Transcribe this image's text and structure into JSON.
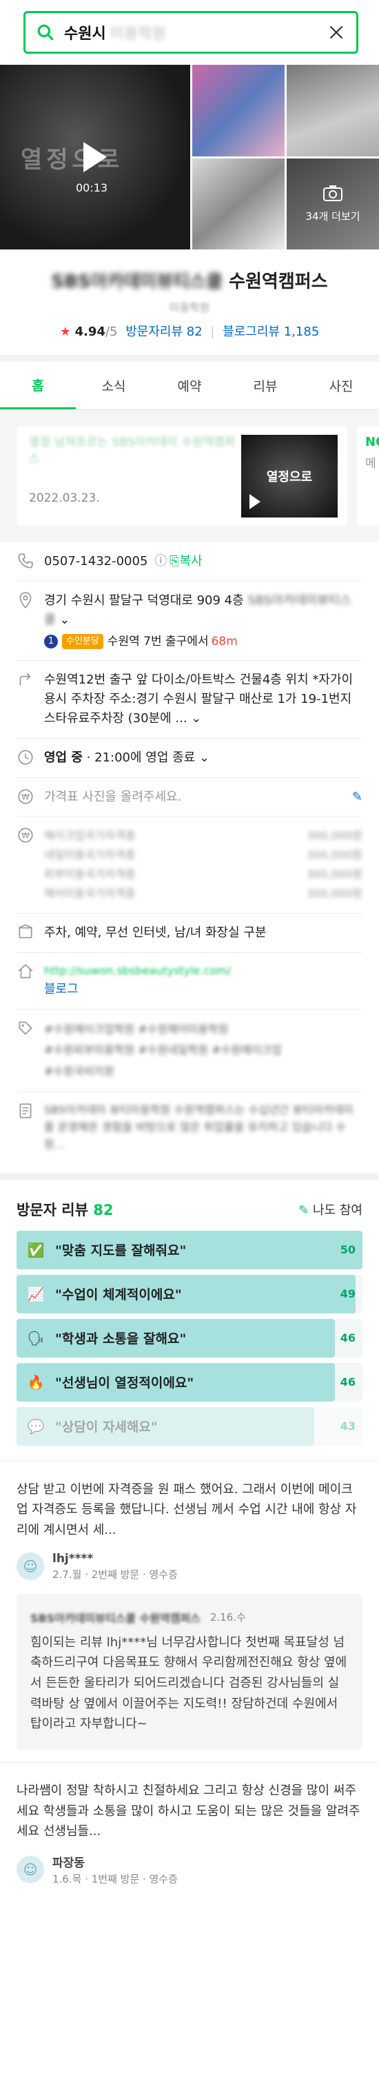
{
  "search": {
    "query": "수원시",
    "query_blurred": "미용학원"
  },
  "gallery": {
    "video_duration": "00:13",
    "video_caption": "열정으로",
    "more_label": "34개 더보기"
  },
  "place": {
    "name_blurred": "SBS아카데미뷰티스쿨",
    "name": "수원역캠퍼스",
    "category": "미용학원",
    "rating": "4.94",
    "rating_max": "/5",
    "visitor_reviews": "방문자리뷰 82",
    "blog_reviews": "블로그리뷰 1,185"
  },
  "tabs": [
    "홈",
    "소식",
    "예약",
    "리뷰",
    "사진"
  ],
  "news": {
    "title": "열정 넘쳐흐르는 SBS아카데미 수원역캠퍼스",
    "date": "2022.03.23.",
    "thumb_text": "열정으로",
    "peek_title": "NO",
    "peek_sub": "메"
  },
  "info": {
    "phone": "0507-1432-0005",
    "copy": "복사",
    "address": "경기 수원시 팔달구 덕영대로 909 4층",
    "address_blurred": "SBS아카데미뷰티스쿨",
    "subway_num": "1",
    "subway_line": "수인분당",
    "subway_text": "수원역 7번 출구에서",
    "subway_dist": "68m",
    "directions": "수원역12번 출구 앞 다이소/아트박스 건물4층 위치 *자가이용시 주차장 주소:경기 수원시 팔달구 매산로 1가 19-1번지 스타유료주차장 (30분에 ...",
    "hours_status": "영업 중",
    "hours_text": "21:00에 영업 종료",
    "price_note": "가격표 사진을 올려주세요.",
    "prices": [
      {
        "name": "메이크업국가자격증",
        "price": "300,000원"
      },
      {
        "name": "네일미용국가자격증",
        "price": "300,000원"
      },
      {
        "name": "피부미용국가자격증",
        "price": "300,000원"
      },
      {
        "name": "헤어미용국가자격증",
        "price": "300,000원"
      }
    ],
    "amenities": "주차, 예약, 무선 인터넷, 남/녀 화장실 구분",
    "url": "http://suwon.sbsbeautystyle.com/",
    "blog": "블로그",
    "tags_line1": "#수원메이크업학원  #수원헤어미용학원",
    "tags_line2": "#수원피부미용학원  #수원네일학원  #수원메이크업",
    "tags_line3": "#수원국비지원",
    "desc": "SBS아카데미 뷰티미용학원 수원역캠퍼스는 수십년간 뷰티아카데미를 운영해온 경험을 바탕으로 많은 취업률을 유지하고 있습니다 수원..."
  },
  "reviews_header": {
    "title": "방문자 리뷰",
    "count": "82",
    "join": "나도 참여"
  },
  "keywords": [
    {
      "emoji": "✅",
      "label": "\"맞춤 지도를 잘해줘요\"",
      "count": 50,
      "fill": 1.0,
      "fade": false
    },
    {
      "emoji": "📈",
      "label": "\"수업이 체계적이에요\"",
      "count": 49,
      "fill": 0.98,
      "fade": false
    },
    {
      "emoji": "🗣",
      "label": "\"학생과 소통을 잘해요\"",
      "count": 46,
      "fill": 0.92,
      "fade": false
    },
    {
      "emoji": "🔥",
      "label": "\"선생님이 열정적이에요\"",
      "count": 46,
      "fill": 0.92,
      "fade": false
    },
    {
      "emoji": "💬",
      "label": "\"상담이 자세해요\"",
      "count": 43,
      "fill": 0.86,
      "fade": true
    }
  ],
  "reviews": [
    {
      "text": "상담 받고 이번에 자격증을 원 패스 했어요. 그래서 이번에 메이크업 자격증도 등록을 했답니다. 선생님 께서 수업 시간 내에 항상 자리에 계시면서 세...",
      "name": "lhj****",
      "meta": "2.7.월 · 2번째 방문 · 영수증",
      "reply": {
        "name": "SBS아카데미뷰티스쿨 수원역캠퍼스",
        "date": "2.16.수",
        "text": "힘이되는 리뷰 lhj****님 너무감사합니다 첫번째 목표달성 넘 축하드리구여 다음목표도 향해서 우리함께전진해요 항상 옆에서 든든한 울타리가 되어드리겠습니다 검증된 강사님들의 실력바탕 상 옆에서 이끌어주는 지도력!! 장담하건데 수원에서 탑이라고 자부합니다~"
      }
    },
    {
      "text": "나라쌤이 정말 착하시고 친절하세요 그리고 항상 신경을 많이 써주세요 학생들과 소통을 많이 하시고 도움이 되는 많은 것들을 알려주세요 선생님들...",
      "name": "파장동",
      "meta": "1.6.목 · 1번째 방문 · 영수증"
    }
  ],
  "colors": {
    "brand": "#03c75a",
    "link": "#0068c3",
    "star": "#f0483e",
    "keyword_fill": "#a6e1dd"
  }
}
